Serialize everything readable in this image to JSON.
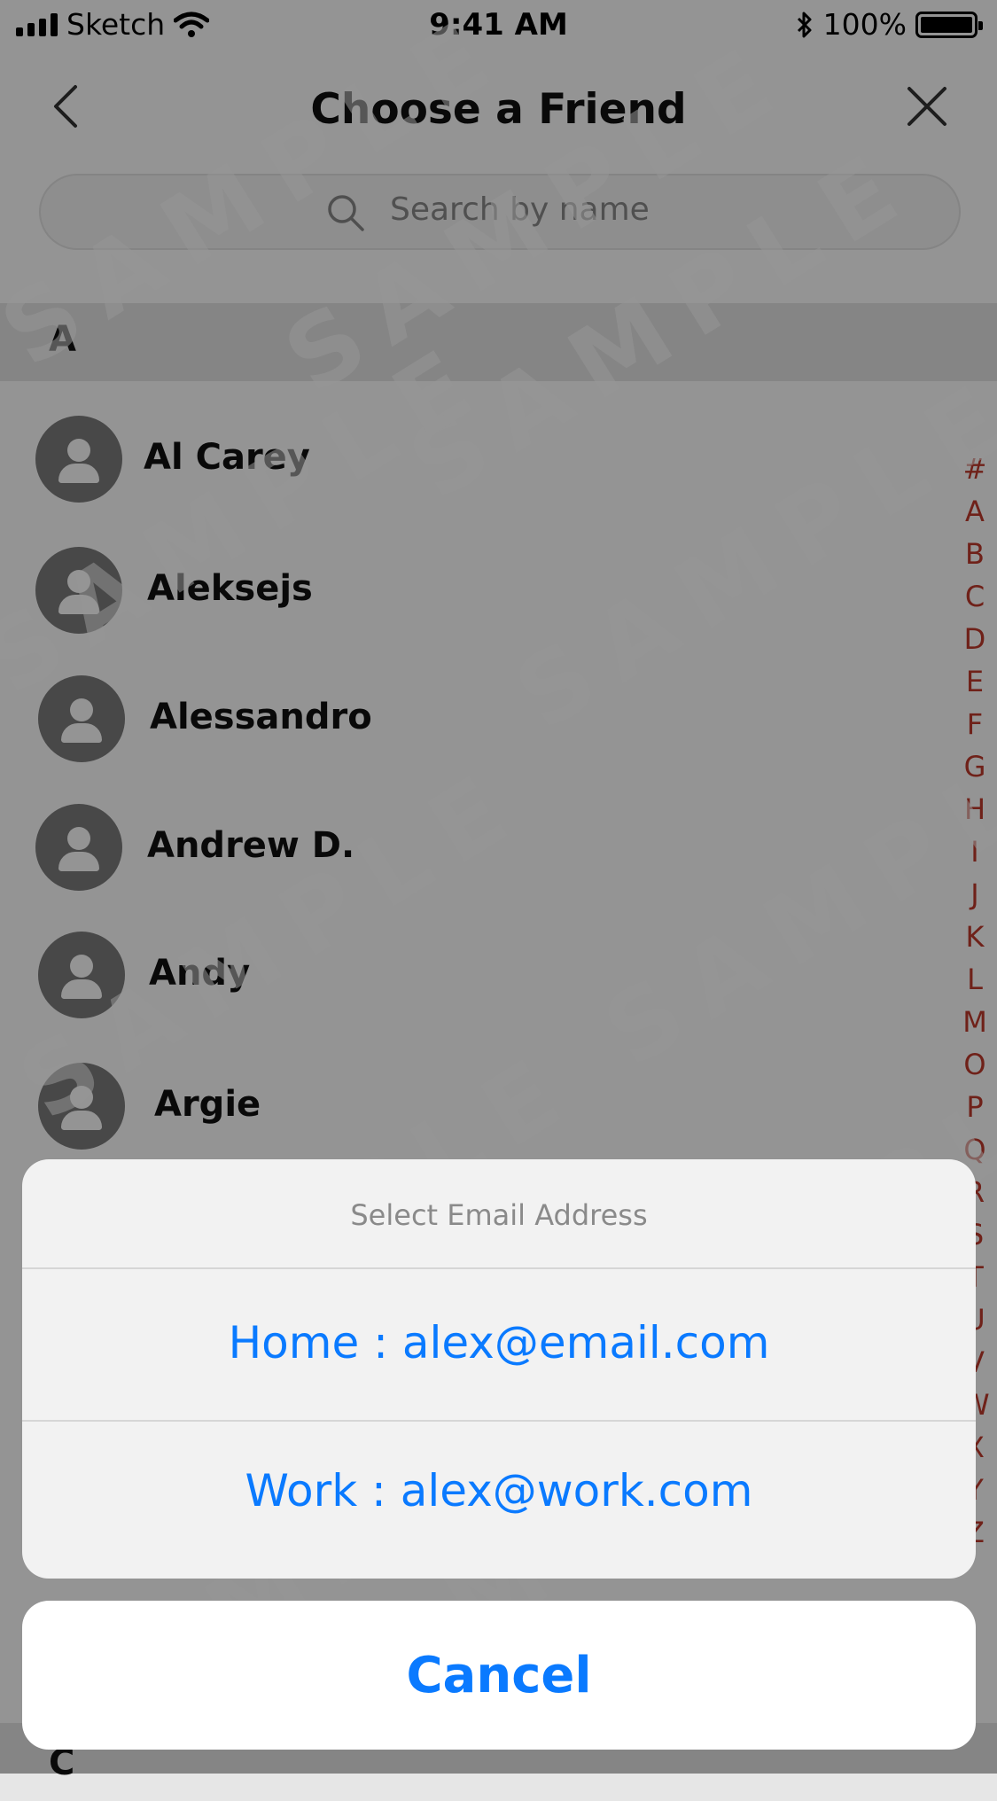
{
  "status_bar": {
    "carrier": "Sketch",
    "time": "9:41 AM",
    "battery": "100%",
    "icons": [
      "signal-icon",
      "wifi-icon",
      "bluetooth-icon",
      "battery-icon"
    ]
  },
  "header": {
    "title": "Choose a Friend",
    "back_icon": "chevron-left-icon",
    "close_icon": "close-icon"
  },
  "search": {
    "placeholder": "Search by name",
    "icon": "search-icon"
  },
  "contacts": {
    "section": "A",
    "items": [
      {
        "name": "Al Carey"
      },
      {
        "name": "Aleksejs"
      },
      {
        "name": "Alessandro"
      },
      {
        "name": "Andrew D."
      },
      {
        "name": "Andy"
      },
      {
        "name": "Argie"
      }
    ],
    "next_section": "C"
  },
  "index_letters": [
    "#",
    "A",
    "B",
    "C",
    "D",
    "E",
    "F",
    "G",
    "H",
    "I",
    "J",
    "K",
    "L",
    "M",
    "O",
    "P",
    "Q",
    "R",
    "S",
    "T",
    "U",
    "V",
    "W",
    "X",
    "Y",
    "Z"
  ],
  "action_sheet": {
    "title": "Select Email Address",
    "options": [
      {
        "label": "Home : alex@email.com"
      },
      {
        "label": "Work : alex@work.com"
      }
    ],
    "cancel_label": "Cancel"
  },
  "watermark": "SAMPLE",
  "colors": {
    "accent": "#0a7aff",
    "index": "#c0392b",
    "dim_overlay": "rgba(0,0,0,0.42)"
  }
}
